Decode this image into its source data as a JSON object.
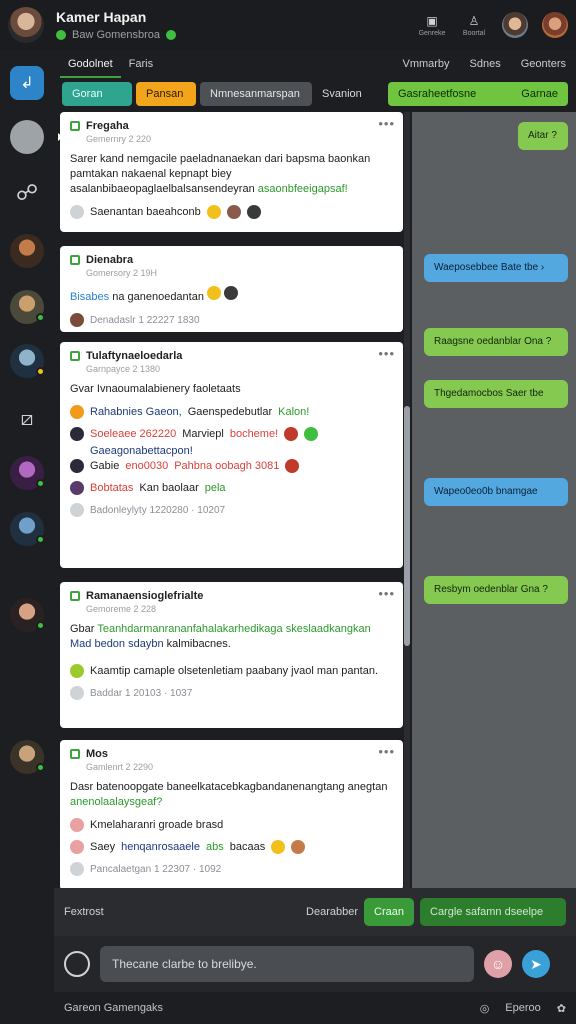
{
  "header": {
    "title": "Kamer Hapan",
    "subtitle": "Baw Gomensbroa",
    "icons": [
      {
        "icon": "folder-icon",
        "label": "Genreke"
      },
      {
        "icon": "user-icon",
        "label": "Boortal"
      }
    ]
  },
  "tabs": {
    "items": [
      "Godolnet",
      "Faris"
    ],
    "right": [
      "Vmmarby",
      "Sdnes",
      "Geonters"
    ]
  },
  "toolbar": {
    "teal": "Goran",
    "orange": "Pansan",
    "grey": "Nmnesanmarspan",
    "plain": "Svanion",
    "green_left": "Gasraheetfosne",
    "green_right": "Garnae"
  },
  "feed": [
    {
      "title": "Fregaha",
      "time": "Gemernry 2 220",
      "body": "Sarer kand nemgacile paeladnanaekan dari bapsma baonkan pamtakan nakaenal kepnapt biey asalanbibaeopaglaelbalsansendeyran",
      "body_green": "asaonbfeeigapsaf!",
      "row_text": "Saenantan baeahconb"
    },
    {
      "title": "Dienabra",
      "time": "Gomersory 2 19H",
      "body_blue": "Bisabes",
      "body": "na ganenoedantan",
      "row_text": "Denadaslr  1 22227  1830"
    },
    {
      "title": "Tulaftynaeloedarla",
      "time": "Garnpayce 2 1380",
      "body": "Gvar Ivnaoumalabienery faoletaats",
      "line1_a": "Rahabnies Gaeon,",
      "line1_b": "Gaenspedebutlar",
      "line1_c": "Kalon!",
      "line2_a": "Soeleaee 262220",
      "line2_b": "Marviepl",
      "line2_c": "bocheme!",
      "line3": "Gaeagonabettacpon!",
      "line4_a": "Gabie",
      "line4_b": "eno0030",
      "line4_c": "Pahbna oobagh 3081",
      "line5_a": "Bobtatas",
      "line5_b": "Kan baolaar",
      "line5_c": "pela",
      "footer": "Badonleylyty  1220280 · 10207"
    },
    {
      "title": "Ramanaensioglefrialte",
      "time": "Gemoreme 2 228",
      "body_a": "Gbar",
      "body_b": "Teanhdarmanrananfahalakarhedikaga",
      "body_c": "skeslaadkangkan",
      "body_d": "Mad bedon",
      "body_e": "sdaybn",
      "body_f": "kalmibacnes.",
      "row_text": "Kaamtip camaple olsetenletiam paabany jvaol man pantan.",
      "footer": "Baddar  1 20103 · 1037"
    },
    {
      "title": "Mos",
      "time": "Gamlenrt 2 2290",
      "body": "Dasr batenoopgate baneelkatacebkagbandanenangtang anegtan",
      "body_green": "anenolaalaysgeaf?",
      "row1": "Kmelaharanri groade brasd",
      "row2_a": "Saey",
      "row2_b": "henqanrosaaele",
      "row2_c": "abs",
      "row2_d": "bacaas",
      "footer": "Pancalaetgan  1 22307 · 1092"
    }
  ],
  "bubbles": [
    {
      "color": "g",
      "text": "Aitar ?"
    },
    {
      "color": "b",
      "text": "Waeposebbee Bate  tbe  ›"
    },
    {
      "color": "g",
      "text": "Raagsne oedanblar   Ona ?"
    },
    {
      "color": "g",
      "text": "Thgedamocbos  Saer  tbe"
    },
    {
      "color": "b",
      "text": "Wapeo0eo0b  bnamgae"
    },
    {
      "color": "g",
      "text": "Resbym oedenblar   Gna ?"
    }
  ],
  "bottom": {
    "left": "Fextrost",
    "middle": "Dearabber",
    "go": "Craan",
    "filter": "Cargle safamn dseelpe"
  },
  "composer": {
    "placeholder": "Thecane clarbe to brelibye."
  },
  "footer": {
    "left": "Gareon Gamengaks",
    "right": "Eperoo"
  },
  "colors": {
    "accent_green": "#3ea33e",
    "accent_blue": "#2d84c8",
    "orange": "#f2a51a",
    "teal": "#2fa58f"
  }
}
